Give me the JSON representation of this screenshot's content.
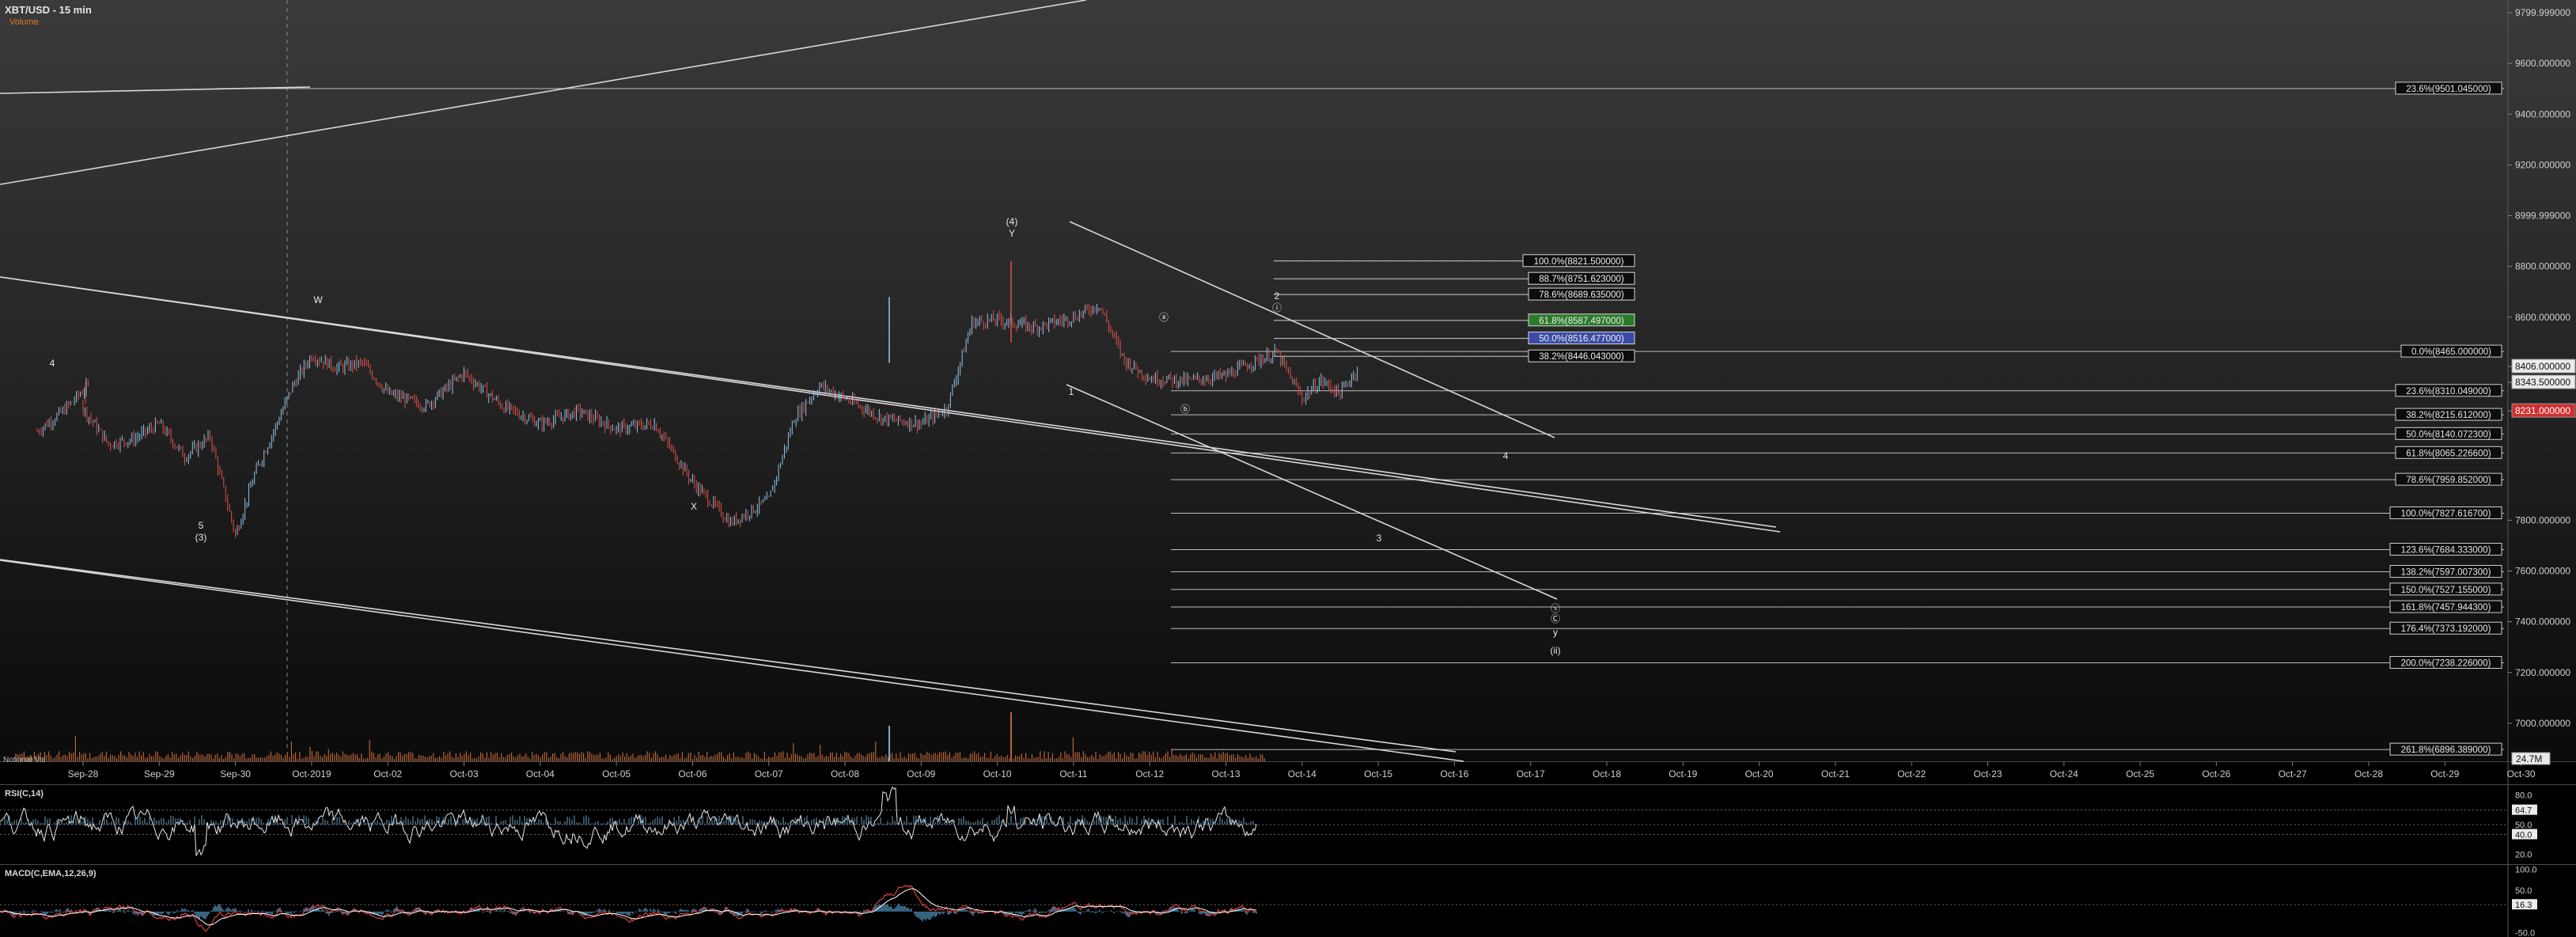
{
  "header": {
    "title": "XBT/USD - 15 min",
    "volume_label": "Volume"
  },
  "colors": {
    "up": "#8ec5e8",
    "down": "#e0504a",
    "grid": "#5a5a5a",
    "axis_text": "#cfcfcf",
    "line": "#d8d8d8",
    "macd": "#e04040",
    "signal": "#ffffff",
    "hist": "#5aa6d6",
    "volume": "#b5653a",
    "highlight_green": "#2a7a2a",
    "highlight_blue": "#3a4aa6"
  },
  "chart_data": [
    {
      "type": "candlestick",
      "title": "XBT/USD - 15 min",
      "y_ticks": [
        "9799.999000",
        "9600.000000",
        "9400.000000",
        "9200.000000",
        "8999.999000",
        "8800.000000",
        "8600.000000",
        "8406.000000",
        "8343.500000",
        "8231.000000",
        "7800.000000",
        "7600.000000",
        "7400.000000",
        "7200.000000",
        "7000.000000"
      ],
      "ylim": [
        6850,
        9850
      ],
      "x_ticks": [
        "Sep-28",
        "Sep-29",
        "Sep-30",
        "Oct-2019",
        "Oct-02",
        "Oct-03",
        "Oct-04",
        "Oct-05",
        "Oct-06",
        "Oct-07",
        "Oct-08",
        "Oct-09",
        "Oct-10",
        "Oct-11",
        "Oct-12",
        "Oct-13",
        "Oct-14",
        "Oct-15",
        "Oct-16",
        "Oct-17",
        "Oct-18",
        "Oct-19",
        "Oct-20",
        "Oct-21",
        "Oct-22",
        "Oct-23",
        "Oct-24",
        "Oct-25",
        "Oct-26",
        "Oct-27",
        "Oct-28",
        "Oct-29",
        "Oct-30"
      ],
      "price_path": [
        [
          "Sep-27",
          8150
        ],
        [
          "Sep-27",
          8230
        ],
        [
          "Sep-27",
          8330
        ],
        [
          "Sep-28",
          8240
        ],
        [
          "Sep-28",
          8100
        ],
        [
          "Sep-28",
          8120
        ],
        [
          "Sep-29",
          8180
        ],
        [
          "Sep-29",
          8050
        ],
        [
          "Sep-29",
          8130
        ],
        [
          "Sep-30",
          7740
        ],
        [
          "Sep-30",
          7980
        ],
        [
          "Sep-30",
          8150
        ],
        [
          "Sep-30",
          8330
        ],
        [
          "Oct-2019",
          8450
        ],
        [
          "Oct-2019",
          8400
        ],
        [
          "Oct-2019",
          8420
        ],
        [
          "Oct-02",
          8300
        ],
        [
          "Oct-02",
          8250
        ],
        [
          "Oct-03",
          8380
        ],
        [
          "Oct-03",
          8250
        ],
        [
          "Oct-04",
          8180
        ],
        [
          "Oct-04",
          8230
        ],
        [
          "Oct-05",
          8160
        ],
        [
          "Oct-05",
          8180
        ],
        [
          "Oct-06",
          7950
        ],
        [
          "Oct-06",
          7790
        ],
        [
          "Oct-07",
          7880
        ],
        [
          "Oct-07",
          8200
        ],
        [
          "Oct-07",
          8330
        ],
        [
          "Oct-08",
          8280
        ],
        [
          "Oct-08",
          8200
        ],
        [
          "Oct-09",
          8180
        ],
        [
          "Oct-09",
          8240
        ],
        [
          "Oct-09",
          8580
        ],
        [
          "Oct-10",
          8590
        ],
        [
          "Oct-10",
          8560
        ],
        [
          "Oct-11",
          8600
        ],
        [
          "Oct-11",
          8650
        ],
        [
          "Oct-11",
          8430
        ],
        [
          "Oct-12",
          8360
        ],
        [
          "Oct-12",
          8350
        ],
        [
          "Oct-13",
          8370
        ],
        [
          "Oct-13",
          8420
        ],
        [
          "Oct-13",
          8460
        ],
        [
          "Oct-14",
          8280
        ],
        [
          "Oct-14",
          8350
        ],
        [
          "Oct-14",
          8300
        ],
        [
          "Oct-14",
          8406
        ]
      ],
      "fib_levels": [
        "23.6%(9501.045000)",
        "0.0%(8465.000000)",
        "23.6%(8310.049000)",
        "38.2%(8215.612000)",
        "50.0%(8140.072300)",
        "61.8%(8065.226600)",
        "78.6%(7959.852000)",
        "100.0%(7827.616700)",
        "123.6%(7684.333000)",
        "138.2%(7597.007300)",
        "150.0%(7527.155000)",
        "161.8%(7457.944300)",
        "176.4%(7373.192000)",
        "200.0%(7238.226000)",
        "261.8%(6896.389000)"
      ],
      "retrace_levels": [
        "100.0%(8821.500000)",
        "88.7%(8751.623000)",
        "78.6%(8689.635000)",
        "61.8%(8587.497000)",
        "50.0%(8516.477000)",
        "38.2%(8446.043000)"
      ],
      "wave_labels": [
        "4",
        "5",
        "(3)",
        "W",
        "X",
        "(4)",
        "Y",
        "1",
        "2",
        "3",
        "4",
        "ⓐ",
        "ⓑ",
        "ⓘ",
        "ⓢ",
        "Ⓒ",
        "y",
        "(ii)"
      ],
      "volume_axis": "24.7M",
      "volume_caption": "Notional Vol"
    },
    {
      "type": "line",
      "title": "RSI(C,14)",
      "y_ticks": [
        "80.0",
        "64.7",
        "50.0",
        "40.0",
        "20.0"
      ],
      "ylim": [
        10,
        90
      ]
    },
    {
      "type": "line",
      "title": "MACD(C,EMA,12,26,9)",
      "y_ticks": [
        "100.0",
        "50.0",
        "16.3",
        "-50.0"
      ],
      "ylim": [
        -60,
        110
      ]
    }
  ]
}
